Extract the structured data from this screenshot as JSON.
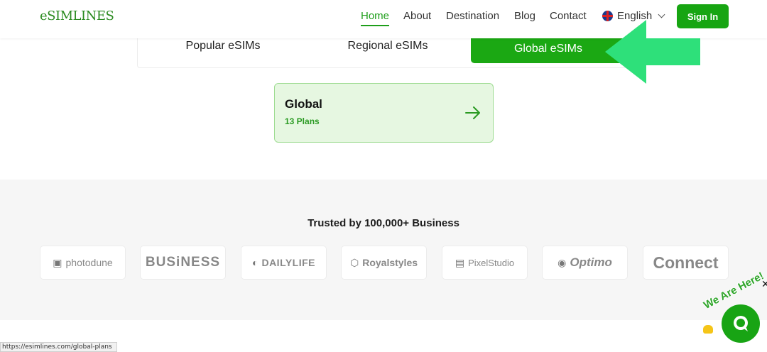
{
  "header": {
    "logo": "eSIMLINES",
    "nav": [
      "Home",
      "About",
      "Destination",
      "Blog",
      "Contact"
    ],
    "active_nav": "Home",
    "language": "English",
    "sign_in": "Sign In"
  },
  "tabs": [
    "Popular eSIMs",
    "Regional eSIMs",
    "Global eSIMs"
  ],
  "active_tab": "Global eSIMs",
  "region_card": {
    "title": "Global",
    "subtitle": "13 Plans"
  },
  "trusted": {
    "title": "Trusted by 100,000+ Business",
    "brands": [
      "photodune",
      "BUSiNESS",
      "DAILYLIFE",
      "Royalstyles",
      "PixelStudio",
      "Optimo",
      "Connect"
    ]
  },
  "status_url": "https://esimlines.com/global-plans",
  "chat": {
    "label": "We Are Here!"
  },
  "colors": {
    "accent": "#17a512",
    "card_bg": "#e6f7e1",
    "arrow_overlay": "#2ee07a"
  }
}
